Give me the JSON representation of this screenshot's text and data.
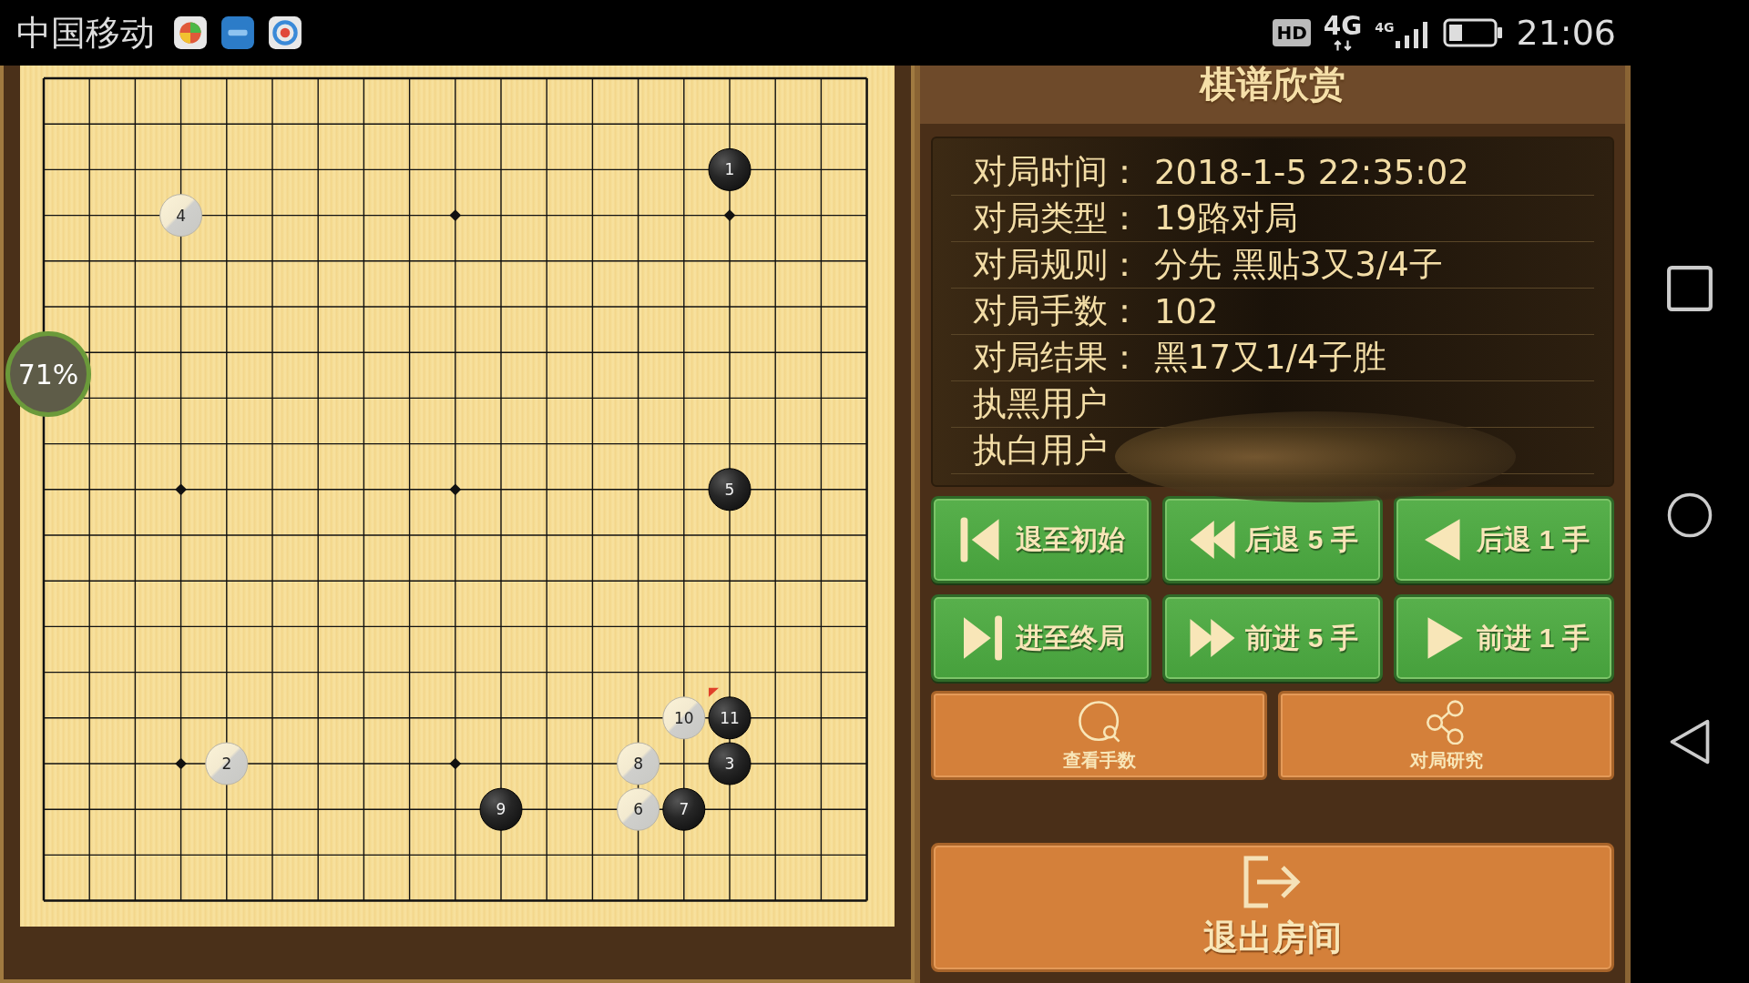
{
  "status_bar": {
    "carrier": "中国移动",
    "hd": "HD",
    "network": "4G",
    "signal_network": "4G",
    "time": "21:06"
  },
  "board": {
    "win_rate": "71%",
    "stones": [
      {
        "number": "1",
        "kind": "black",
        "last_move": false
      },
      {
        "number": "2",
        "kind": "white",
        "last_move": false
      },
      {
        "number": "3",
        "kind": "black",
        "last_move": false
      },
      {
        "number": "4",
        "kind": "white",
        "last_move": false
      },
      {
        "number": "5",
        "kind": "black",
        "last_move": false
      },
      {
        "number": "6",
        "kind": "white",
        "last_move": false
      },
      {
        "number": "7",
        "kind": "black",
        "last_move": false
      },
      {
        "number": "8",
        "kind": "white",
        "last_move": false
      },
      {
        "number": "9",
        "kind": "black",
        "last_move": false
      },
      {
        "number": "10",
        "kind": "white",
        "last_move": false
      },
      {
        "number": "11",
        "kind": "black",
        "last_move": true
      }
    ]
  },
  "panel": {
    "title": "棋谱欣赏",
    "info": [
      {
        "label": "对局时间：",
        "value": "2018-1-5 22:35:02"
      },
      {
        "label": "对局类型：",
        "value": "19路对局"
      },
      {
        "label": "对局规则：",
        "value": "分先 黑贴3又3/4子"
      },
      {
        "label": "对局手数：",
        "value": "102"
      },
      {
        "label": "对局结果：",
        "value": "黑17又1/4子胜"
      },
      {
        "label": "执黑用户"
      },
      {
        "label": "执白用户"
      }
    ],
    "nav_buttons": [
      {
        "kind": "first",
        "label": "退至初始"
      },
      {
        "kind": "back5",
        "label": "后退 5 手"
      },
      {
        "kind": "back1",
        "label": "后退 1 手"
      },
      {
        "kind": "last",
        "label": "进至终局"
      },
      {
        "kind": "forward5",
        "label": "前进 5 手"
      },
      {
        "kind": "forward1",
        "label": "前进 1 手"
      }
    ],
    "tool_buttons": [
      {
        "kind": "count",
        "label": "查看手数"
      },
      {
        "kind": "study",
        "label": "对局研究"
      }
    ],
    "exit_button": {
      "label": "退出房间"
    }
  }
}
